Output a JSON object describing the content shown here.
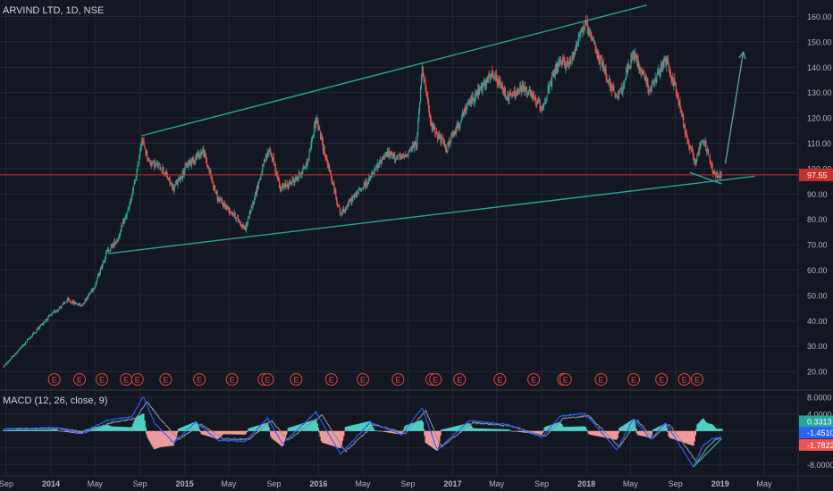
{
  "symbol_title": "ARVIND LTD, 1D, NSE",
  "indicator_title": "MACD (12, 26, close, 9)",
  "colors": {
    "background": "#131722",
    "grid": "#232837",
    "axis_text": "#b2b5be",
    "candle_up": "#26a69a",
    "candle_down": "#ef5350",
    "trendline": "#26a69a",
    "arrow": "#5b9aa0",
    "price_line": "#c9302c",
    "earnings": "#e0453b",
    "dividend": "#2962ff",
    "macd_line": "#2962ff",
    "signal_line": "#8a8d96",
    "hist_up": "#4dd0c4",
    "hist_down": "#ef9a9a"
  },
  "chart_data": {
    "type": "candlestick",
    "title": "ARVIND LTD, 1D, NSE",
    "x_ticks": [
      "Sep",
      "2014",
      "May",
      "Sep",
      "2015",
      "May",
      "Sep",
      "2016",
      "May",
      "Sep",
      "2017",
      "May",
      "Sep",
      "2018",
      "May",
      "Sep",
      "2019",
      "May"
    ],
    "x_tick_dates": [
      "2013-09-01",
      "2014-01-01",
      "2014-05-01",
      "2014-09-01",
      "2015-01-01",
      "2015-05-01",
      "2015-09-01",
      "2016-01-01",
      "2016-05-01",
      "2016-09-01",
      "2017-01-01",
      "2017-05-01",
      "2017-09-01",
      "2018-01-01",
      "2018-05-01",
      "2018-09-01",
      "2019-01-01",
      "2019-05-01"
    ],
    "price_axis_ticks": [
      "160.00",
      "150.00",
      "140.00",
      "130.00",
      "120.00",
      "110.00",
      "100.00",
      "90.00",
      "80.00",
      "70.00",
      "60.00",
      "50.00",
      "40.00",
      "30.00",
      "20.00"
    ],
    "price_ylim": [
      13,
      163
    ],
    "last_price": 97.55,
    "last_price_label": "97.55",
    "price_path": [
      {
        "date": "2013-08-25",
        "price": 22
      },
      {
        "date": "2013-10-15",
        "price": 30
      },
      {
        "date": "2013-12-15",
        "price": 40
      },
      {
        "date": "2014-02-15",
        "price": 48
      },
      {
        "date": "2014-03-25",
        "price": 46
      },
      {
        "date": "2014-05-01",
        "price": 54
      },
      {
        "date": "2014-06-01",
        "price": 67
      },
      {
        "date": "2014-07-01",
        "price": 72
      },
      {
        "date": "2014-08-05",
        "price": 86
      },
      {
        "date": "2014-08-25",
        "price": 100
      },
      {
        "date": "2014-09-05",
        "price": 112
      },
      {
        "date": "2014-09-25",
        "price": 103
      },
      {
        "date": "2014-11-01",
        "price": 100
      },
      {
        "date": "2014-12-01",
        "price": 92
      },
      {
        "date": "2015-01-10",
        "price": 102
      },
      {
        "date": "2015-02-20",
        "price": 107
      },
      {
        "date": "2015-04-01",
        "price": 88
      },
      {
        "date": "2015-05-15",
        "price": 82
      },
      {
        "date": "2015-06-15",
        "price": 76
      },
      {
        "date": "2015-08-01",
        "price": 100
      },
      {
        "date": "2015-08-20",
        "price": 108
      },
      {
        "date": "2015-09-20",
        "price": 92
      },
      {
        "date": "2015-11-01",
        "price": 96
      },
      {
        "date": "2015-12-01",
        "price": 102
      },
      {
        "date": "2015-12-25",
        "price": 120
      },
      {
        "date": "2016-01-20",
        "price": 105
      },
      {
        "date": "2016-03-01",
        "price": 82
      },
      {
        "date": "2016-04-01",
        "price": 88
      },
      {
        "date": "2016-05-20",
        "price": 96
      },
      {
        "date": "2016-07-01",
        "price": 106
      },
      {
        "date": "2016-08-15",
        "price": 104
      },
      {
        "date": "2016-09-25",
        "price": 110
      },
      {
        "date": "2016-10-10",
        "price": 141
      },
      {
        "date": "2016-11-01",
        "price": 118
      },
      {
        "date": "2016-12-15",
        "price": 108
      },
      {
        "date": "2017-02-15",
        "price": 126
      },
      {
        "date": "2017-04-20",
        "price": 137
      },
      {
        "date": "2017-06-01",
        "price": 128
      },
      {
        "date": "2017-07-15",
        "price": 132
      },
      {
        "date": "2017-09-01",
        "price": 124
      },
      {
        "date": "2017-10-15",
        "price": 141
      },
      {
        "date": "2017-11-20",
        "price": 142
      },
      {
        "date": "2017-12-10",
        "price": 152
      },
      {
        "date": "2017-12-28",
        "price": 157
      },
      {
        "date": "2018-02-15",
        "price": 140
      },
      {
        "date": "2018-03-25",
        "price": 127
      },
      {
        "date": "2018-05-10",
        "price": 145
      },
      {
        "date": "2018-06-25",
        "price": 131
      },
      {
        "date": "2018-08-05",
        "price": 143
      },
      {
        "date": "2018-09-05",
        "price": 130
      },
      {
        "date": "2018-10-01",
        "price": 112
      },
      {
        "date": "2018-10-25",
        "price": 103
      },
      {
        "date": "2018-11-15",
        "price": 112
      },
      {
        "date": "2018-12-15",
        "price": 98
      },
      {
        "date": "2019-01-05",
        "price": 97.5
      }
    ],
    "trendlines": [
      {
        "from": {
          "date": "2014-09-05",
          "price": 113
        },
        "to": {
          "date": "2018-06-15",
          "price": 164.5
        }
      },
      {
        "from": {
          "date": "2014-06-05",
          "price": 66.5
        },
        "to": {
          "date": "2019-04-05",
          "price": 97
        }
      },
      {
        "from": {
          "date": "2018-10-10",
          "price": 98.5
        },
        "to": {
          "date": "2019-01-05",
          "price": 94
        }
      }
    ],
    "arrow": {
      "from": {
        "date": "2019-01-15",
        "price": 102
      },
      "to": {
        "date": "2019-03-05",
        "price": 146
      }
    },
    "earnings_marker_label": "E",
    "earnings_markers": [
      "2014-01-10",
      "2014-03-20",
      "2014-05-20",
      "2014-07-25",
      "2014-08-25",
      "2014-11-10",
      "2015-02-10",
      "2015-05-10",
      "2015-08-05",
      "2015-08-15",
      "2015-11-01",
      "2016-02-05",
      "2016-05-01",
      "2016-08-05",
      "2016-11-05",
      "2016-11-15",
      "2017-01-20",
      "2017-05-10",
      "2017-08-10",
      "2017-10-30",
      "2017-11-05",
      "2018-02-10",
      "2018-05-10",
      "2018-07-25",
      "2018-09-25",
      "2018-10-30"
    ],
    "macd": {
      "title": "MACD (12, 26, close, 9)",
      "axis_ticks": [
        "8.0000",
        "4.0000",
        "0.0000",
        "-4.0000",
        "-8.0000"
      ],
      "ylim": [
        -10,
        9.5
      ],
      "histogram_value_label": "0.3313",
      "macd_value_label": "-1.4510",
      "signal_value_label": "-1.7822",
      "macd_path": [
        {
          "date": "2013-08-25",
          "value": 0.5
        },
        {
          "date": "2014-01-15",
          "value": 0.8
        },
        {
          "date": "2014-03-25",
          "value": -0.6
        },
        {
          "date": "2014-06-01",
          "value": 2.5
        },
        {
          "date": "2014-08-10",
          "value": 3.4
        },
        {
          "date": "2014-09-10",
          "value": 8.3
        },
        {
          "date": "2014-10-10",
          "value": 2.0
        },
        {
          "date": "2014-12-01",
          "value": -2.8
        },
        {
          "date": "2015-02-01",
          "value": 2.2
        },
        {
          "date": "2015-04-01",
          "value": -2.2
        },
        {
          "date": "2015-06-15",
          "value": -2.5
        },
        {
          "date": "2015-08-15",
          "value": 3.0
        },
        {
          "date": "2015-09-25",
          "value": -3.0
        },
        {
          "date": "2015-12-25",
          "value": 4.5
        },
        {
          "date": "2016-03-01",
          "value": -5.5
        },
        {
          "date": "2016-05-20",
          "value": 2.0
        },
        {
          "date": "2016-08-15",
          "value": -0.8
        },
        {
          "date": "2016-10-10",
          "value": 5.5
        },
        {
          "date": "2016-11-20",
          "value": -4.5
        },
        {
          "date": "2017-02-15",
          "value": 2.5
        },
        {
          "date": "2017-06-01",
          "value": 1.5
        },
        {
          "date": "2017-09-01",
          "value": -1.5
        },
        {
          "date": "2017-10-20",
          "value": 3.5
        },
        {
          "date": "2017-12-28",
          "value": 4.2
        },
        {
          "date": "2018-03-25",
          "value": -4.5
        },
        {
          "date": "2018-05-10",
          "value": 3.0
        },
        {
          "date": "2018-06-25",
          "value": -2.0
        },
        {
          "date": "2018-08-05",
          "value": 2.0
        },
        {
          "date": "2018-10-20",
          "value": -8.5
        },
        {
          "date": "2018-11-15",
          "value": -3.5
        },
        {
          "date": "2018-12-10",
          "value": -1.8
        },
        {
          "date": "2019-01-05",
          "value": -1.45
        }
      ],
      "signal_path": [
        {
          "date": "2013-08-25",
          "value": 0.4
        },
        {
          "date": "2014-01-25",
          "value": 0.6
        },
        {
          "date": "2014-04-05",
          "value": -0.3
        },
        {
          "date": "2014-06-15",
          "value": 2.0
        },
        {
          "date": "2014-08-20",
          "value": 3.0
        },
        {
          "date": "2014-09-20",
          "value": 7.0
        },
        {
          "date": "2014-10-25",
          "value": 3.0
        },
        {
          "date": "2014-12-15",
          "value": -2.0
        },
        {
          "date": "2015-02-15",
          "value": 1.6
        },
        {
          "date": "2015-04-15",
          "value": -1.8
        },
        {
          "date": "2015-06-25",
          "value": -2.0
        },
        {
          "date": "2015-08-25",
          "value": 2.5
        },
        {
          "date": "2015-10-10",
          "value": -2.2
        },
        {
          "date": "2016-01-10",
          "value": 3.8
        },
        {
          "date": "2016-03-15",
          "value": -4.8
        },
        {
          "date": "2016-06-01",
          "value": 1.5
        },
        {
          "date": "2016-08-25",
          "value": -0.5
        },
        {
          "date": "2016-10-20",
          "value": 4.8
        },
        {
          "date": "2016-12-01",
          "value": -3.8
        },
        {
          "date": "2017-02-25",
          "value": 2.0
        },
        {
          "date": "2017-06-10",
          "value": 1.2
        },
        {
          "date": "2017-09-10",
          "value": -1.2
        },
        {
          "date": "2017-10-30",
          "value": 3.0
        },
        {
          "date": "2018-01-08",
          "value": 3.6
        },
        {
          "date": "2018-04-01",
          "value": -3.8
        },
        {
          "date": "2018-05-20",
          "value": 2.5
        },
        {
          "date": "2018-07-01",
          "value": -1.6
        },
        {
          "date": "2018-08-15",
          "value": 1.6
        },
        {
          "date": "2018-10-30",
          "value": -7.5
        },
        {
          "date": "2018-11-25",
          "value": -4.0
        },
        {
          "date": "2018-12-20",
          "value": -2.0
        },
        {
          "date": "2019-01-05",
          "value": -1.78
        }
      ],
      "divergence_line": {
        "from": {
          "date": "2018-10-20",
          "value": -8.5
        },
        "to": {
          "date": "2019-01-05",
          "value": -1.8
        }
      }
    }
  }
}
